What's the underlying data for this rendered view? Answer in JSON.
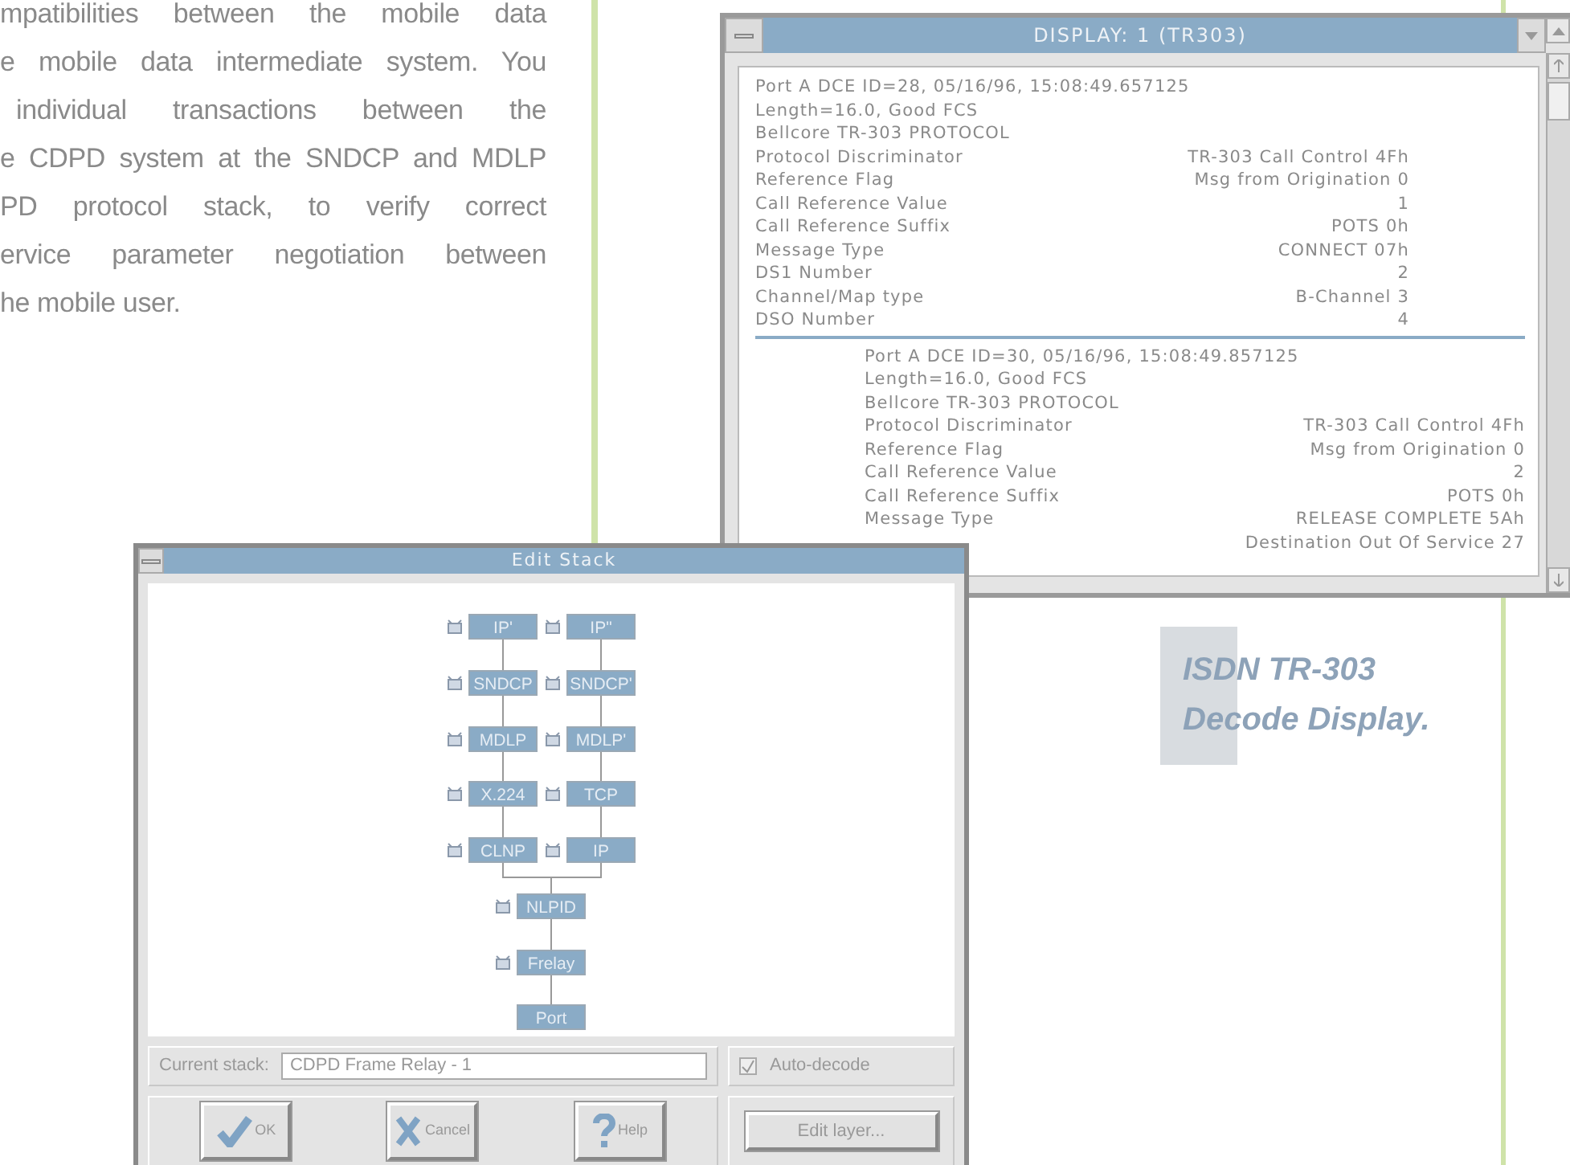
{
  "paragraph_lines": [
    "mpatibilities between the mobile data",
    "e mobile data intermediate system. You",
    "individual transactions between the",
    "e CDPD system at the SNDCP and MDLP",
    "PD protocol stack, to verify correct",
    "ervice parameter negotiation between",
    "he mobile user."
  ],
  "display_window": {
    "title": "DISPLAY: 1 (TR303)",
    "records": [
      {
        "lines": [
          "Port A DCE ID=28, 05/16/96, 15:08:49.657125",
          "Length=16.0, Good FCS",
          "Bellcore TR-303 PROTOCOL"
        ],
        "fields": [
          {
            "label": "Protocol Discriminator",
            "value": "TR-303 Call Control 4Fh"
          },
          {
            "label": "Reference Flag",
            "value": "Msg from Origination 0"
          },
          {
            "label": "Call Reference Value",
            "value": "1"
          },
          {
            "label": "Call Reference Suffix",
            "value": "POTS 0h"
          },
          {
            "label": "Message Type",
            "value": "CONNECT 07h"
          },
          {
            "label": "DS1 Number",
            "value": "2"
          },
          {
            "label": "Channel/Map type",
            "value": "B-Channel 3"
          },
          {
            "label": "DSO Number",
            "value": "4"
          }
        ]
      },
      {
        "lines": [
          "Port A DCE ID=30, 05/16/96, 15:08:49.857125",
          "Length=16.0, Good FCS",
          "Bellcore TR-303 PROTOCOL"
        ],
        "fields": [
          {
            "label": "Protocol Discriminator",
            "value": "TR-303 Call Control 4Fh"
          },
          {
            "label": "Reference Flag",
            "value": "Msg from Origination 0"
          },
          {
            "label": "Call Reference Value",
            "value": "2"
          },
          {
            "label": "Call Reference Suffix",
            "value": "POTS 0h"
          },
          {
            "label": "Message Type",
            "value": "RELEASE COMPLETE 5Ah"
          },
          {
            "value": "Destination Out Of Service 27"
          }
        ]
      }
    ]
  },
  "edit_stack": {
    "title": "Edit Stack",
    "branches": [
      [
        {
          "label": "IP'",
          "kind": "layer"
        },
        {
          "label": "SNDCP",
          "kind": "layer"
        },
        {
          "label": "MDLP",
          "kind": "layer"
        },
        {
          "label": "X.224",
          "kind": "layer"
        },
        {
          "label": "CLNP",
          "kind": "layer"
        }
      ],
      [
        {
          "label": "IP\"",
          "kind": "layer"
        },
        {
          "label": "SNDCP'",
          "kind": "layer"
        },
        {
          "label": "MDLP'",
          "kind": "layer"
        },
        {
          "label": "TCP",
          "kind": "layer"
        },
        {
          "label": "IP",
          "kind": "layer"
        }
      ]
    ],
    "common": [
      {
        "label": "NLPID",
        "kind": "layer"
      },
      {
        "label": "Frelay",
        "kind": "layer"
      },
      {
        "label": "Port",
        "kind": "port"
      }
    ],
    "current_stack_label": "Current stack:",
    "current_stack_value": "CDPD Frame Relay - 1",
    "auto_decode": {
      "label": "Auto-decode",
      "checked": true,
      "disabled": true
    },
    "buttons": [
      {
        "label": "OK",
        "kind": "check"
      },
      {
        "label": "Cancel",
        "kind": "cancel"
      },
      {
        "label": "Help",
        "kind": "help"
      }
    ],
    "edit_layer_button": "Edit layer..."
  },
  "caption": [
    "ISDN TR-303",
    "Decode Display."
  ]
}
